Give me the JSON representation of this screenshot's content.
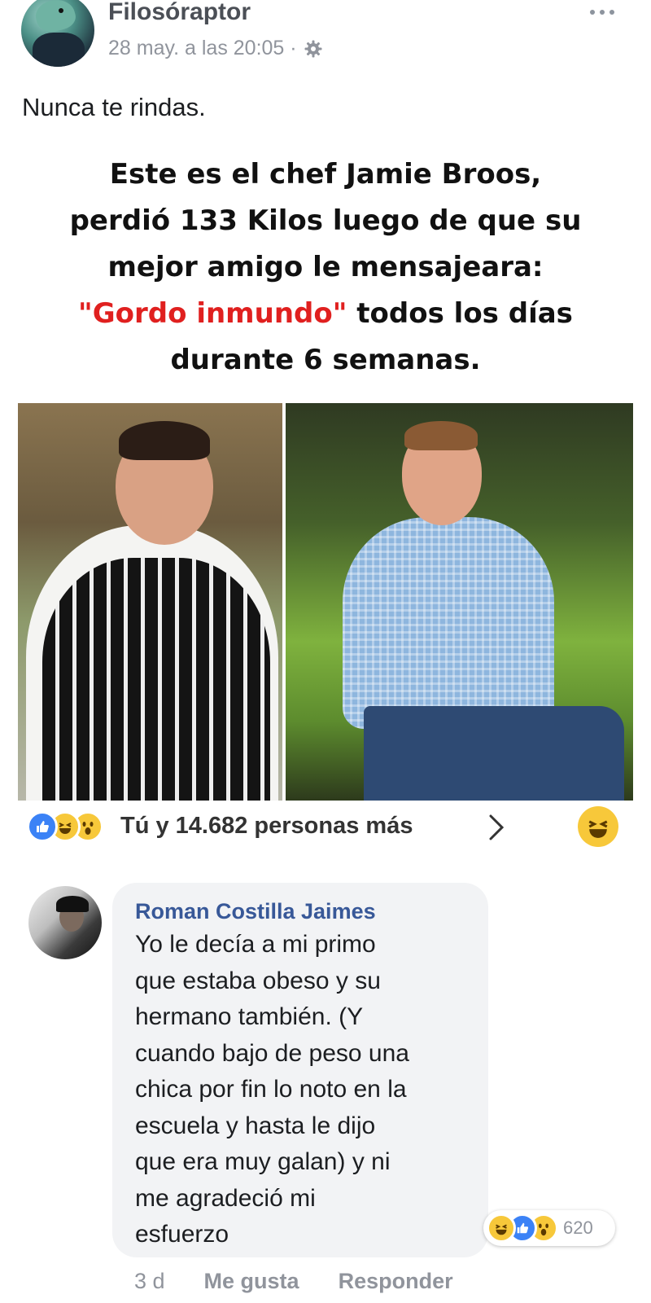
{
  "post": {
    "author": "Filosóraptor",
    "timestamp": "28 may. a las 20:05 ·",
    "privacy_icon": "gear-icon",
    "more_icon": "more-options-icon",
    "text": "Nunca te rindas."
  },
  "meme": {
    "caption_line1": "Este es el chef Jamie Broos,",
    "caption_line2": "perdió 133 Kilos luego de que su",
    "caption_line3": "mejor amigo le mensajeara:",
    "caption_quote": "\"Gordo inmundo\"",
    "caption_line4_rest": "todos los días",
    "caption_line5": "durante 6 semanas.",
    "quote_color": "#e0201f"
  },
  "reactions": {
    "icons": [
      "like-icon",
      "haha-icon",
      "wow-icon"
    ],
    "summary": "Tú y 14.682 personas más",
    "my_reaction": "haha-icon"
  },
  "comment": {
    "author": "Roman Costilla Jaimes",
    "lines": [
      "Yo le decía a mi primo",
      "que estaba obeso y su",
      "hermano también. (Y",
      "cuando bajo de peso una",
      "chica por fin lo noto en la",
      "escuela y hasta le dijo",
      "que era muy galan) y ni",
      "me agradeció mi",
      "esfuerzo"
    ],
    "reaction_icons": [
      "haha-icon",
      "like-icon",
      "wow-icon"
    ],
    "reaction_count": "620",
    "time": "3 d",
    "like_label": "Me gusta",
    "reply_label": "Responder"
  },
  "colors": {
    "link_blue": "#385898",
    "like_blue": "#3b82f6",
    "emoji_yellow": "#f7c83a",
    "bubble_gray": "#f2f3f5"
  }
}
